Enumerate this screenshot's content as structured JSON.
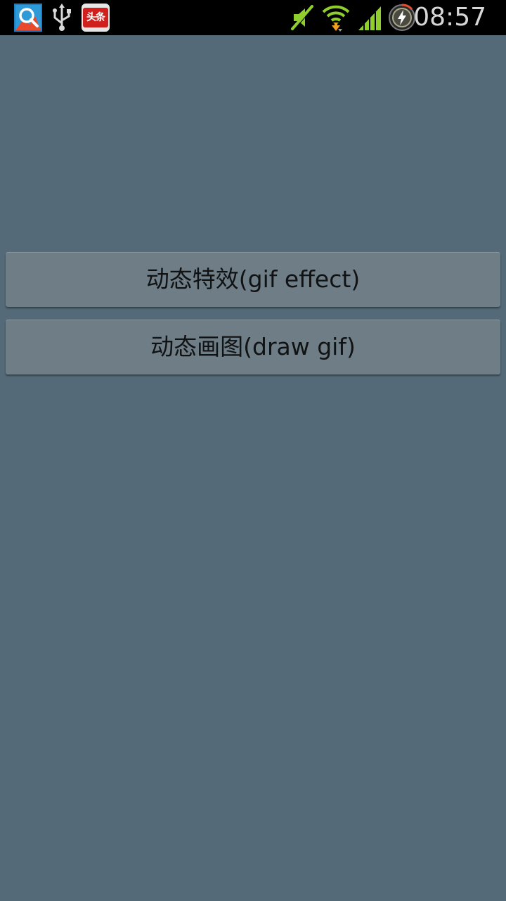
{
  "status_bar": {
    "time": "08:57",
    "notification_icons": [
      "search-app-icon",
      "usb-icon",
      "toutiao-icon"
    ],
    "system_icons": [
      "mute-icon",
      "wifi-icon",
      "signal-icon",
      "battery-charging-icon"
    ],
    "toutiao_label": "头条",
    "colors": {
      "background": "#000000",
      "wifi": "#8fce2b",
      "mute": "#8fce2b",
      "signal": "#8fce2b",
      "arrow_orange": "#f0a020",
      "toutiao_red": "#d0201e"
    }
  },
  "main": {
    "background_color": "#546a78",
    "buttons": [
      {
        "label": "动态特效(gif effect)"
      },
      {
        "label": "动态画图(draw gif)"
      }
    ],
    "button_color": "#6e7d86"
  }
}
